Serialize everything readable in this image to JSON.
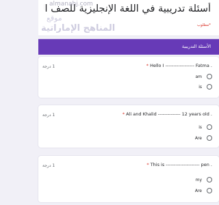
{
  "form": {
    "title": "أسئلة تدريبية في اللغة الإنجليزية للصف السادس",
    "required_note": "*مطلوب"
  },
  "watermark": {
    "url": "almanahj.com",
    "text_1": "موقع",
    "text_2": "المناهج الإماراتية"
  },
  "section": {
    "title": "الأسئلة التدريبية"
  },
  "questions": [
    {
      "text": "Hello I ------------------ Fatma .",
      "required_mark": "*",
      "points": "1 درجة",
      "options": [
        "am",
        "is"
      ]
    },
    {
      "text": "Ali and Khalid -------------- 12 years old .",
      "required_mark": "*",
      "points": "1 درجة",
      "options": [
        "is",
        "Are"
      ]
    },
    {
      "text": "This is --------------------- pen .",
      "required_mark": "*",
      "points": "1 درجة",
      "options": [
        "my",
        "Are"
      ]
    }
  ],
  "colors": {
    "accent": "#673ab7",
    "background": "#f1f0f7",
    "required": "#d93025"
  }
}
